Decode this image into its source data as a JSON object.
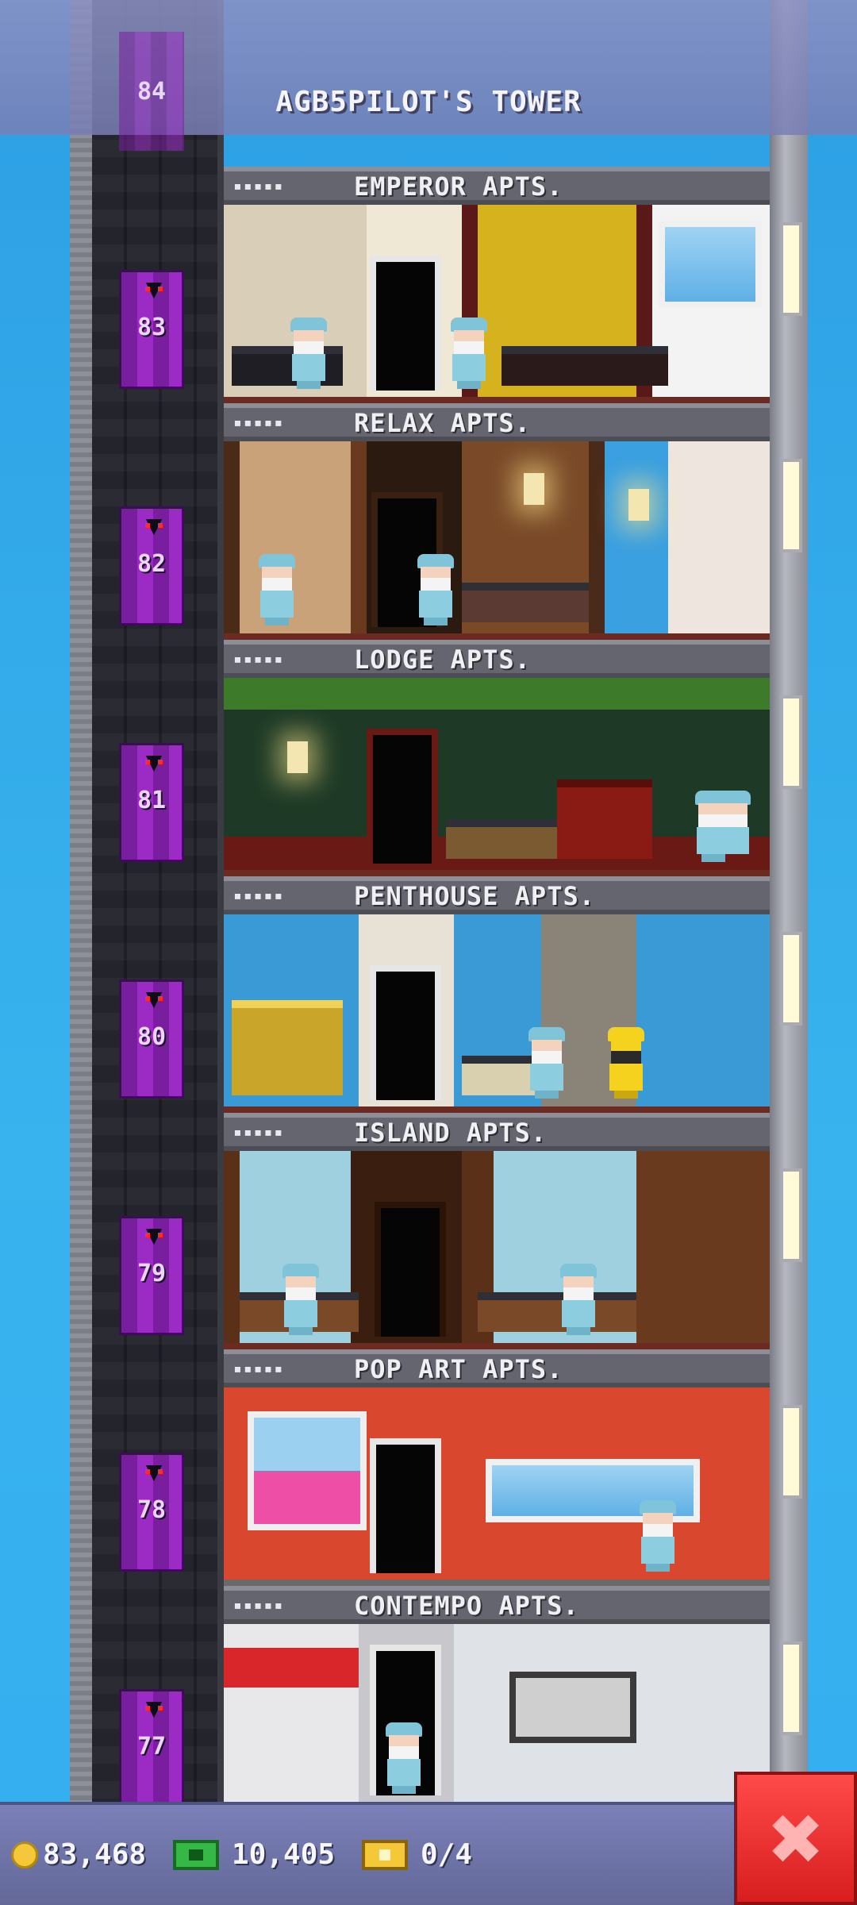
{
  "header": {
    "title": "AGB5PILOT'S TOWER",
    "top_floor_number": "84"
  },
  "floors": [
    {
      "number": "83",
      "name": "EMPEROR APTS.",
      "pips": "▪▪▪▪▪"
    },
    {
      "number": "82",
      "name": "RELAX APTS.",
      "pips": "▪▪▪▪▪"
    },
    {
      "number": "81",
      "name": "LODGE APTS.",
      "pips": "▪▪▪▪▪"
    },
    {
      "number": "80",
      "name": "PENTHOUSE APTS.",
      "pips": "▪▪▪▪▪"
    },
    {
      "number": "79",
      "name": "ISLAND APTS.",
      "pips": "▪▪▪▪▪"
    },
    {
      "number": "78",
      "name": "POP ART APTS.",
      "pips": "▪▪▪▪▪"
    },
    {
      "number": "77",
      "name": "CONTEMPO APTS.",
      "pips": "▪▪▪▪▪"
    }
  ],
  "status_bar": {
    "coins": "83,468",
    "bux": "10,405",
    "tickets": "0/4"
  },
  "close_button": {
    "label": "✖"
  },
  "icons": {
    "coin": "coin-icon",
    "bux": "bux-icon",
    "ticket": "ticket-icon",
    "close": "close-icon",
    "elevator_bat": "bat-icon"
  },
  "colors": {
    "sky": "#2fa8e8",
    "elevator": "#9b2bc4",
    "status_bar": "#6d72a8",
    "close": "#e62b2b"
  }
}
